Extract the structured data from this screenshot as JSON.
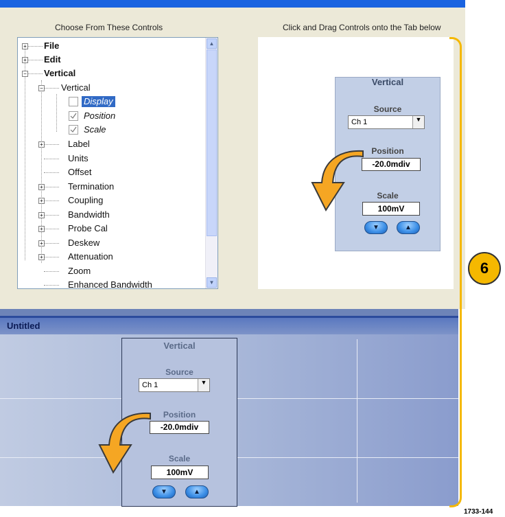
{
  "top": {
    "left_header": "Choose From These Controls",
    "right_header": "Click and Drag Controls onto the Tab below"
  },
  "tree": {
    "file": "File",
    "edit": "Edit",
    "vertical_group": "Vertical",
    "vertical_sub": "Vertical",
    "display": "Display",
    "position": "Position",
    "scale": "Scale",
    "label": "Label",
    "units": "Units",
    "offset": "Offset",
    "termination": "Termination",
    "coupling": "Coupling",
    "bandwidth": "Bandwidth",
    "probe_cal": "Probe Cal",
    "deskew": "Deskew",
    "attenuation": "Attenuation",
    "zoom": "Zoom",
    "enhanced_bandwidth": "Enhanced Bandwidth"
  },
  "panel": {
    "title": "Vertical",
    "source_label": "Source",
    "source_value": "Ch 1",
    "position_label": "Position",
    "position_value": "-20.0mdiv",
    "scale_label": "Scale",
    "scale_value": "100mV"
  },
  "lower": {
    "window_title": "Untitled"
  },
  "icons": {
    "plus": "+",
    "minus": "−",
    "dropdown": "▼",
    "down": "▼",
    "up": "▲",
    "scroll_up": "▲",
    "scroll_down": "▼"
  },
  "callout_number": "6",
  "figure_id": "1733-144",
  "colors": {
    "accent": "#f5b800",
    "selection": "#316ac5",
    "topbar": "#1a63e0"
  }
}
